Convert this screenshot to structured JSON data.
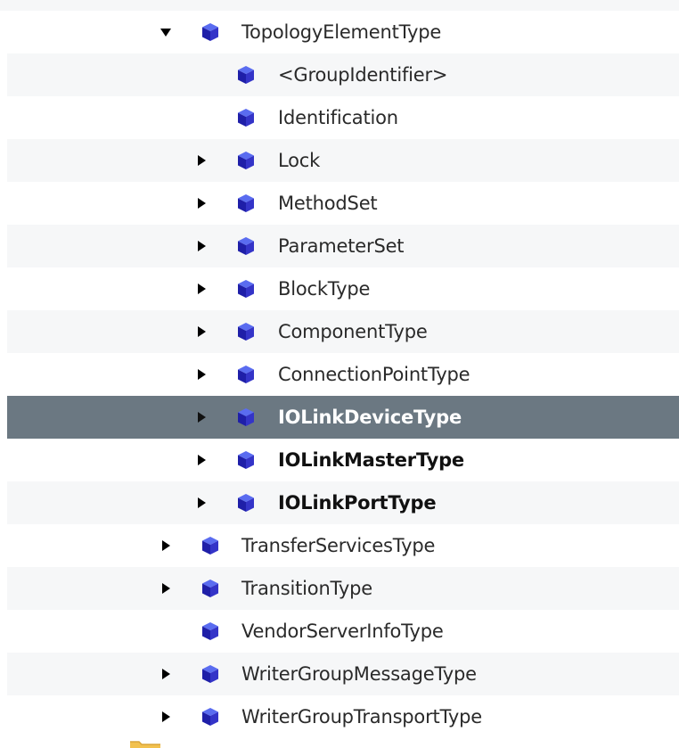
{
  "tree": {
    "items": [
      {
        "label": "TopologyElementType",
        "level": 0,
        "expander": "expanded",
        "icon": "object-type-cube-icon",
        "bold": false,
        "selected": false
      },
      {
        "label": "<GroupIdentifier>",
        "level": 1,
        "expander": "none",
        "icon": "object-type-cube-icon",
        "bold": false,
        "selected": false
      },
      {
        "label": "Identification",
        "level": 1,
        "expander": "none",
        "icon": "object-type-cube-icon",
        "bold": false,
        "selected": false
      },
      {
        "label": "Lock",
        "level": 1,
        "expander": "collapsed",
        "icon": "object-type-cube-icon",
        "bold": false,
        "selected": false
      },
      {
        "label": "MethodSet",
        "level": 1,
        "expander": "collapsed",
        "icon": "object-type-cube-icon",
        "bold": false,
        "selected": false
      },
      {
        "label": "ParameterSet",
        "level": 1,
        "expander": "collapsed",
        "icon": "object-type-cube-icon",
        "bold": false,
        "selected": false
      },
      {
        "label": "BlockType",
        "level": 1,
        "expander": "collapsed",
        "icon": "object-type-cube-icon",
        "bold": false,
        "selected": false
      },
      {
        "label": "ComponentType",
        "level": 1,
        "expander": "collapsed",
        "icon": "object-type-cube-icon",
        "bold": false,
        "selected": false
      },
      {
        "label": "ConnectionPointType",
        "level": 1,
        "expander": "collapsed",
        "icon": "object-type-cube-icon",
        "bold": false,
        "selected": false
      },
      {
        "label": "IOLinkDeviceType",
        "level": 1,
        "expander": "collapsed",
        "icon": "object-type-cube-icon",
        "bold": true,
        "selected": true
      },
      {
        "label": "IOLinkMasterType",
        "level": 1,
        "expander": "collapsed",
        "icon": "object-type-cube-icon",
        "bold": true,
        "selected": false
      },
      {
        "label": "IOLinkPortType",
        "level": 1,
        "expander": "collapsed",
        "icon": "object-type-cube-icon",
        "bold": true,
        "selected": false
      },
      {
        "label": "TransferServicesType",
        "level": 0,
        "expander": "collapsed",
        "icon": "object-type-cube-icon",
        "bold": false,
        "selected": false
      },
      {
        "label": "TransitionType",
        "level": 0,
        "expander": "collapsed",
        "icon": "object-type-cube-icon",
        "bold": false,
        "selected": false
      },
      {
        "label": "VendorServerInfoType",
        "level": 0,
        "expander": "none",
        "icon": "object-type-cube-icon",
        "bold": false,
        "selected": false
      },
      {
        "label": "WriterGroupMessageType",
        "level": 0,
        "expander": "collapsed",
        "icon": "object-type-cube-icon",
        "bold": false,
        "selected": false
      },
      {
        "label": "WriterGroupTransportType",
        "level": 0,
        "expander": "collapsed",
        "icon": "object-type-cube-icon",
        "bold": false,
        "selected": false
      }
    ]
  },
  "colors": {
    "row_alt_background": "#f6f7f8",
    "selected_background": "#6b7882",
    "selected_text": "#ffffff",
    "text": "#2a2a2a",
    "icon_blue_light": "#5a6cf0",
    "icon_blue_dark": "#1f1fa8",
    "folder_yellow": "#f2c14e"
  }
}
